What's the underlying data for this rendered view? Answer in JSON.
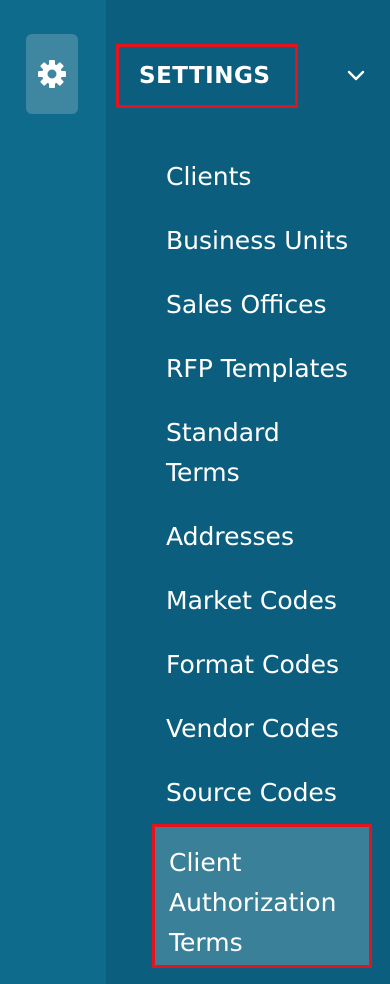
{
  "rail": {
    "settings_icon": "gear-icon"
  },
  "section": {
    "title": "SETTINGS",
    "toggle_icon": "chevron-down-icon"
  },
  "menu": {
    "items": [
      {
        "label": "Clients"
      },
      {
        "label": "Business Units"
      },
      {
        "label": "Sales Offices"
      },
      {
        "label": "RFP Templates"
      },
      {
        "label": "Standard Terms"
      },
      {
        "label": "Addresses"
      },
      {
        "label": "Market Codes"
      },
      {
        "label": "Format Codes"
      },
      {
        "label": "Vendor Codes"
      },
      {
        "label": "Source Codes"
      },
      {
        "label": "Client Authorization Terms",
        "active": true
      }
    ]
  },
  "colors": {
    "rail_bg": "#0f6b8c",
    "panel_bg": "#0b5e7e",
    "icon_button_bg": "#3f86a1",
    "active_item_bg": "#3a8099",
    "highlight_border": "#e3141b",
    "text": "#ffffff"
  }
}
